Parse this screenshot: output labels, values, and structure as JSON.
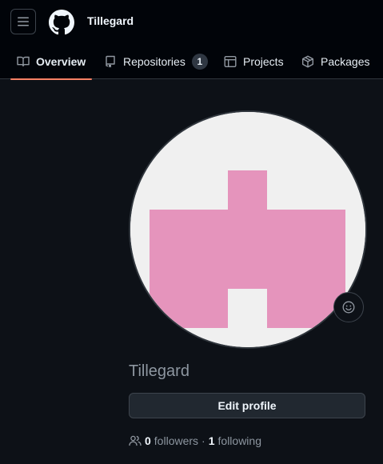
{
  "header": {
    "owner_name": "Tillegard"
  },
  "tabs": [
    {
      "label": "Overview",
      "icon": "book-icon",
      "active": true
    },
    {
      "label": "Repositories",
      "icon": "repo-icon",
      "count": "1"
    },
    {
      "label": "Projects",
      "icon": "table-icon"
    },
    {
      "label": "Packages",
      "icon": "package-icon"
    }
  ],
  "profile": {
    "nickname": "Tillegard",
    "edit_label": "Edit profile",
    "followers_count": "0",
    "followers_label": "followers",
    "separator": "·",
    "following_count": "1",
    "following_label": "following"
  },
  "colors": {
    "background": "#0d1117",
    "header": "#010409",
    "accent_underline": "#f78166",
    "identicon": "#e594bc",
    "identicon_bg": "#f0f0f0"
  }
}
